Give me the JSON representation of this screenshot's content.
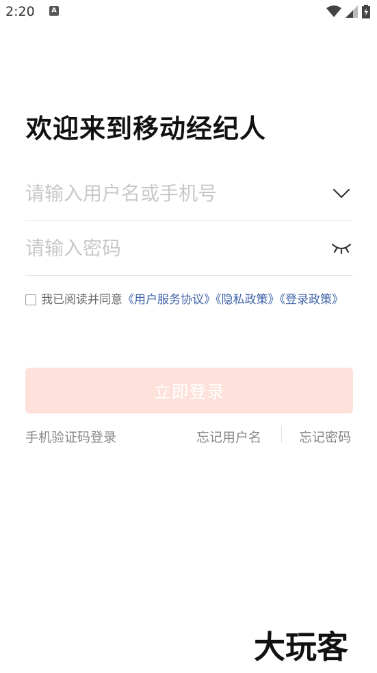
{
  "status_bar": {
    "time": "2:20",
    "notification_glyph": "A",
    "icons": [
      "wifi-icon",
      "signal-icon",
      "battery-charging-icon"
    ]
  },
  "title": "欢迎来到移动经纪人",
  "username_field": {
    "placeholder": "请输入用户名或手机号",
    "value": "",
    "icon": "chevron-down-icon"
  },
  "password_field": {
    "placeholder": "请输入密码",
    "value": "",
    "icon": "eye-closed-icon"
  },
  "agreement": {
    "checked": false,
    "prefix": "我已阅读并同意",
    "links": [
      "《用户服务协议》",
      "《隐私政策》",
      "《登录政策》"
    ]
  },
  "login_button": {
    "label": "立即登录",
    "bg_color": "#fde1da"
  },
  "links": {
    "sms_login": "手机验证码登录",
    "forgot_username": "忘记用户名",
    "forgot_password": "忘记密码"
  },
  "watermark": {
    "text": "大玩客",
    "type": "logo"
  },
  "colors": {
    "link": "#3f63a8",
    "placeholder": "#c8c8c8",
    "secondary_text": "#888888"
  }
}
